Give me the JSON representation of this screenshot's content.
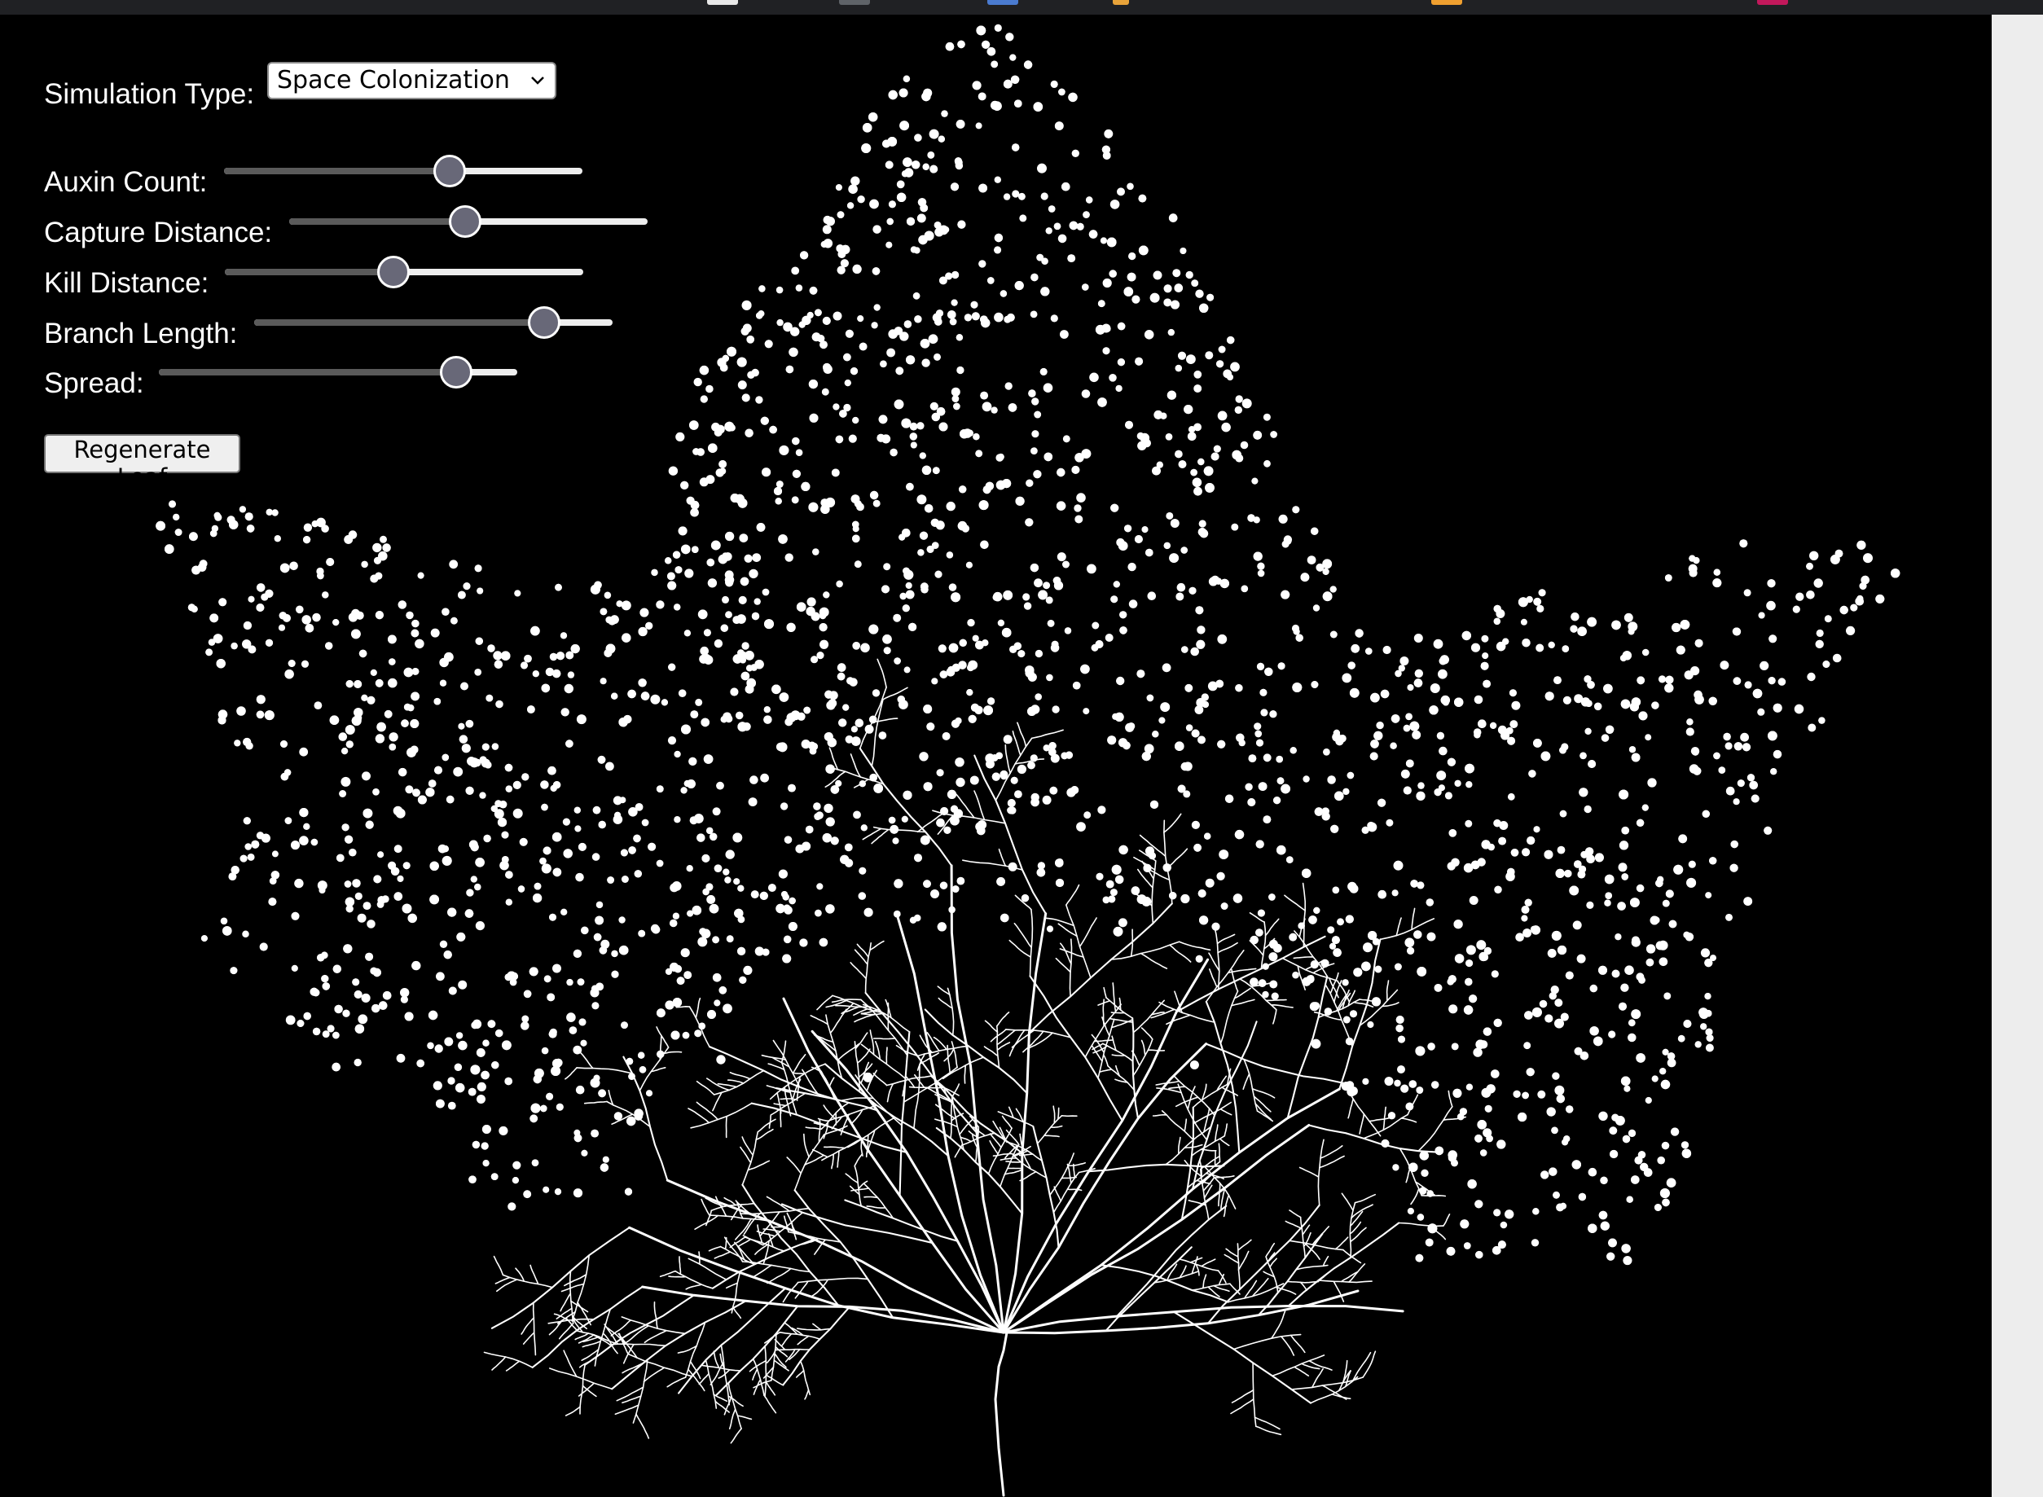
{
  "simulation": {
    "label": "Simulation Type:",
    "selected": "Space Colonization"
  },
  "sliders": [
    {
      "label": "Auxin Count:",
      "value": 0.63
    },
    {
      "label": "Capture Distance:",
      "value": 0.49
    },
    {
      "label": "Kill Distance:",
      "value": 0.47
    },
    {
      "label": "Branch Length:",
      "value": 0.81
    },
    {
      "label": "Spread:",
      "value": 0.83
    }
  ],
  "regenerate_label": "Regenerate Leaf",
  "colors": {
    "background": "#000000",
    "auxin": "#ffffff",
    "vein": "#ffffff",
    "slider_thumb": "#686878"
  },
  "icons": [
    "chevron-down-icon"
  ]
}
